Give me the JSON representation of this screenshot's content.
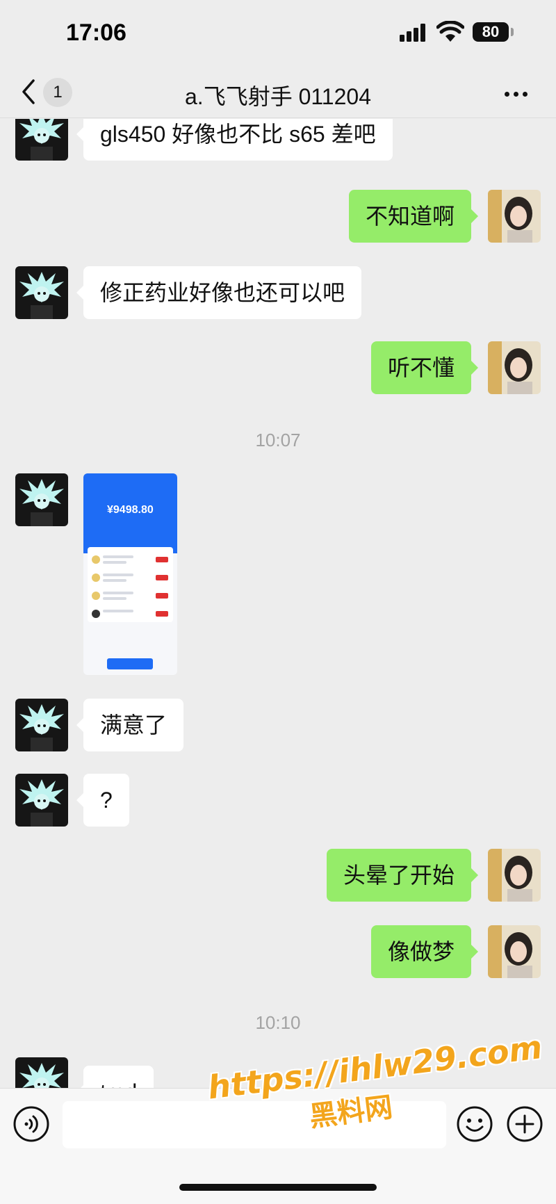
{
  "status_bar": {
    "time": "17:06",
    "battery": "80",
    "icons": [
      "signal-icon",
      "wifi-icon",
      "battery-icon"
    ]
  },
  "header": {
    "back_icon": "chevron-left-icon",
    "unread_count": "1",
    "title": "a.飞飞射手 011204",
    "more_icon": "ellipsis-icon"
  },
  "messages": [
    {
      "side": "in",
      "type": "text",
      "text": "gls450 好像也不比 s65 差吧"
    },
    {
      "side": "out",
      "type": "text",
      "text": "不知道啊"
    },
    {
      "side": "in",
      "type": "text",
      "text": "修正药业好像也还可以吧"
    },
    {
      "side": "out",
      "type": "text",
      "text": "听不懂"
    },
    {
      "type": "time",
      "text": "10:07"
    },
    {
      "side": "in",
      "type": "image",
      "image_amount": "¥9498.80"
    },
    {
      "side": "in",
      "type": "text",
      "text": "满意了"
    },
    {
      "side": "in",
      "type": "text",
      "text": "?"
    },
    {
      "side": "out",
      "type": "text",
      "text": "头晕了开始"
    },
    {
      "side": "out",
      "type": "text",
      "text": "像做梦"
    },
    {
      "type": "time",
      "text": "10:10"
    },
    {
      "side": "in",
      "type": "text",
      "text": "tmd"
    }
  ],
  "input_bar": {
    "voice_icon": "voice-icon",
    "emoji_icon": "emoji-icon",
    "plus_icon": "plus-icon"
  },
  "watermark": {
    "url": "https://ihlw29.com",
    "name": "黑料网"
  },
  "colors": {
    "background": "#ededed",
    "outgoing_bubble": "#95ec69",
    "incoming_bubble": "#ffffff",
    "watermark": "#f3a51c"
  }
}
